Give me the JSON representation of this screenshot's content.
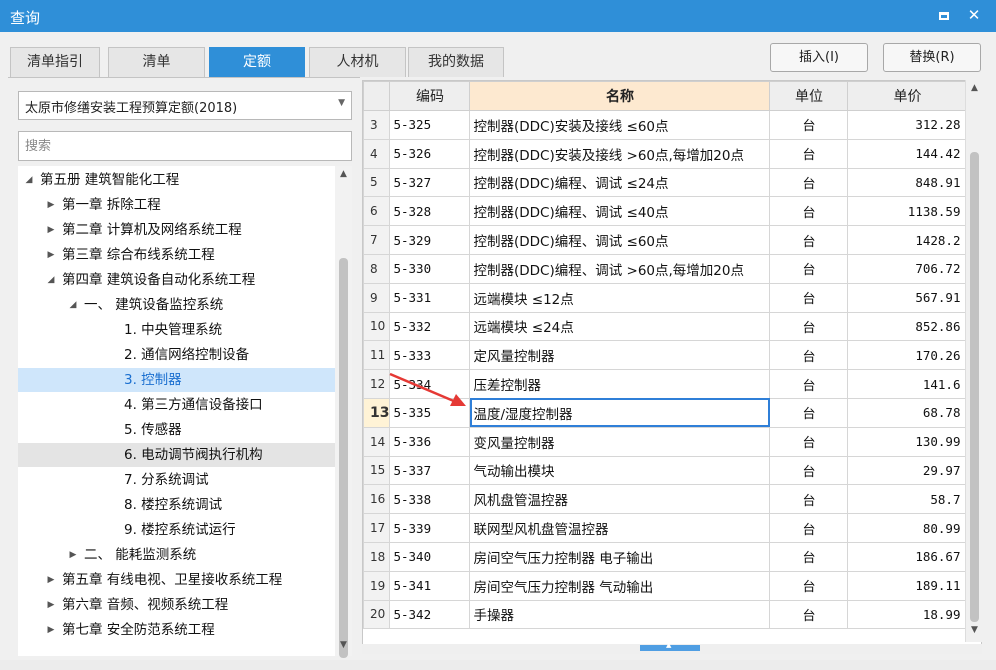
{
  "window": {
    "title": "查询",
    "max_icon": "maximize-icon",
    "close_icon": "close-icon",
    "close_glyph": "✕"
  },
  "tabs": [
    {
      "label": "清单指引",
      "active": false
    },
    {
      "label": "清单",
      "active": false
    },
    {
      "label": "定额",
      "active": true
    },
    {
      "label": "人材机",
      "active": false
    },
    {
      "label": "我的数据",
      "active": false
    }
  ],
  "buttons": {
    "insert": "插入(I)",
    "replace": "替换(R)"
  },
  "library": {
    "selected": "太原市修缮安装工程预算定额(2018)",
    "arrow_icon": "chevron-down-icon"
  },
  "search": {
    "placeholder": "搜索"
  },
  "tree": [
    {
      "label": "第五册 建筑智能化工程",
      "expand": "◢",
      "state": ""
    },
    {
      "label": "第一章 拆除工程",
      "expand": "▶",
      "state": ""
    },
    {
      "label": "第二章 计算机及网络系统工程",
      "expand": "▶",
      "state": ""
    },
    {
      "label": "第三章 综合布线系统工程",
      "expand": "▶",
      "state": ""
    },
    {
      "label": "第四章 建筑设备自动化系统工程",
      "expand": "◢",
      "state": ""
    },
    {
      "label": "一、 建筑设备监控系统",
      "expand": "◢",
      "state": ""
    },
    {
      "label": "1. 中央管理系统",
      "expand": "",
      "state": ""
    },
    {
      "label": "2. 通信网络控制设备",
      "expand": "",
      "state": ""
    },
    {
      "label": "3. 控制器",
      "expand": "",
      "state": "selected"
    },
    {
      "label": "4. 第三方通信设备接口",
      "expand": "",
      "state": ""
    },
    {
      "label": "5. 传感器",
      "expand": "",
      "state": ""
    },
    {
      "label": "6. 电动调节阀执行机构",
      "expand": "",
      "state": "hover"
    },
    {
      "label": "7. 分系统调试",
      "expand": "",
      "state": ""
    },
    {
      "label": "8. 楼控系统调试",
      "expand": "",
      "state": ""
    },
    {
      "label": "9. 楼控系统试运行",
      "expand": "",
      "state": ""
    },
    {
      "label": "二、 能耗监测系统",
      "expand": "▶",
      "state": ""
    },
    {
      "label": "第五章 有线电视、卫星接收系统工程",
      "expand": "▶",
      "state": ""
    },
    {
      "label": "第六章 音频、视频系统工程",
      "expand": "▶",
      "state": ""
    },
    {
      "label": "第七章 安全防范系统工程",
      "expand": "▶",
      "state": ""
    }
  ],
  "grid": {
    "headers": {
      "code": "编码",
      "name": "名称",
      "unit": "单位",
      "price": "单价"
    },
    "rows": [
      {
        "idx": "3",
        "code": "5-325",
        "name": "控制器(DDC)安装及接线 ≤60点",
        "unit": "台",
        "price": "312.28"
      },
      {
        "idx": "4",
        "code": "5-326",
        "name": "控制器(DDC)安装及接线 >60点,每增加20点",
        "unit": "台",
        "price": "144.42"
      },
      {
        "idx": "5",
        "code": "5-327",
        "name": "控制器(DDC)编程、调试 ≤24点",
        "unit": "台",
        "price": "848.91"
      },
      {
        "idx": "6",
        "code": "5-328",
        "name": "控制器(DDC)编程、调试 ≤40点",
        "unit": "台",
        "price": "1138.59"
      },
      {
        "idx": "7",
        "code": "5-329",
        "name": "控制器(DDC)编程、调试 ≤60点",
        "unit": "台",
        "price": "1428.2"
      },
      {
        "idx": "8",
        "code": "5-330",
        "name": "控制器(DDC)编程、调试 >60点,每增加20点",
        "unit": "台",
        "price": "706.72"
      },
      {
        "idx": "9",
        "code": "5-331",
        "name": "远端模块 ≤12点",
        "unit": "台",
        "price": "567.91"
      },
      {
        "idx": "10",
        "code": "5-332",
        "name": "远端模块 ≤24点",
        "unit": "台",
        "price": "852.86"
      },
      {
        "idx": "11",
        "code": "5-333",
        "name": "定风量控制器",
        "unit": "台",
        "price": "170.26"
      },
      {
        "idx": "12",
        "code": "5-334",
        "name": "压差控制器",
        "unit": "台",
        "price": "141.6"
      },
      {
        "idx": "13",
        "code": "5-335",
        "name": "温度/湿度控制器",
        "unit": "台",
        "price": "68.78",
        "current": true
      },
      {
        "idx": "14",
        "code": "5-336",
        "name": "变风量控制器",
        "unit": "台",
        "price": "130.99"
      },
      {
        "idx": "15",
        "code": "5-337",
        "name": "气动输出模块",
        "unit": "台",
        "price": "29.97"
      },
      {
        "idx": "16",
        "code": "5-338",
        "name": "风机盘管温控器",
        "unit": "台",
        "price": "58.7"
      },
      {
        "idx": "17",
        "code": "5-339",
        "name": "联网型风机盘管温控器",
        "unit": "台",
        "price": "80.99"
      },
      {
        "idx": "18",
        "code": "5-340",
        "name": "房间空气压力控制器 电子输出",
        "unit": "台",
        "price": "186.67"
      },
      {
        "idx": "19",
        "code": "5-341",
        "name": "房间空气压力控制器 气动输出",
        "unit": "台",
        "price": "189.11"
      },
      {
        "idx": "20",
        "code": "5-342",
        "name": "手操器",
        "unit": "台",
        "price": "18.99"
      }
    ]
  },
  "colors": {
    "accent": "#2f8fd8",
    "annotation_arrow": "#e53935",
    "selected_bg": "#cfe6fb",
    "name_header_bg": "#fde9d0"
  }
}
